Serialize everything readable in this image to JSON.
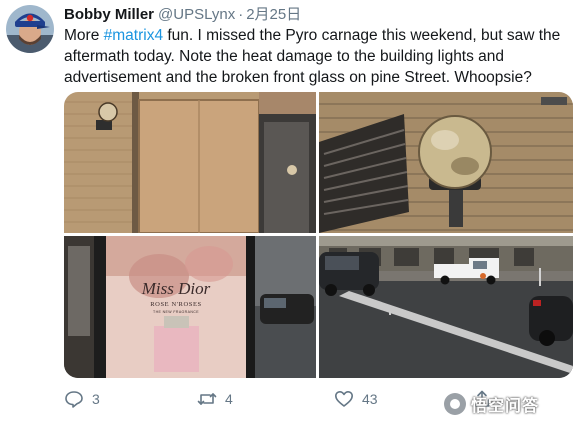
{
  "tweet": {
    "author": {
      "display_name": "Bobby Miller",
      "handle": "@UPSLynx",
      "separator": "·",
      "date": "2月25日"
    },
    "text": {
      "before_hashtag": "More ",
      "hashtag": "#matrix4",
      "after_hashtag": " fun. I missed the Pyro carnage this weekend, but saw the aftermath today. Note the heat damage to the building lights and advertisement and the broken front glass on pine Street. Whoopsie?"
    },
    "media": {
      "photos": [
        {
          "subject": "boarded-up storefront with wall lamp"
        },
        {
          "subject": "scorched wall light fixture"
        },
        {
          "subject": "burned Miss Dior advertisement",
          "ad_text": {
            "brand": "Miss Dior",
            "line1": "ROSE N'ROSES",
            "line2": "THE NEW FRAGRANCE"
          }
        },
        {
          "subject": "street with cars and white pickup truck"
        }
      ]
    },
    "actions": {
      "reply_count": "3",
      "retweet_count": "4",
      "like_count": "43"
    },
    "icons": {
      "reply": "reply-icon",
      "retweet": "retweet-icon",
      "like": "heart-icon",
      "share": "share-icon"
    },
    "colors": {
      "hashtag": "#1b95e0",
      "secondary_text": "#657786",
      "primary_text": "#14171a"
    }
  },
  "watermark": {
    "text": "悟空问答"
  }
}
